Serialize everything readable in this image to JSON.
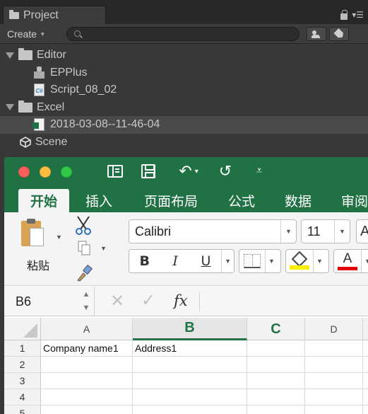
{
  "unity": {
    "panel_tab": "Project",
    "create_label": "Create",
    "search_placeholder": "",
    "tree": [
      {
        "label": "Editor",
        "type": "folder"
      },
      {
        "label": "EPPlus",
        "type": "dll"
      },
      {
        "label": "Script_08_02",
        "type": "cs-script"
      },
      {
        "label": "Excel",
        "type": "folder"
      },
      {
        "label": "2018-03-08--11-46-04",
        "type": "excel-file",
        "selected": true
      },
      {
        "label": "Scene",
        "type": "unity-scene"
      }
    ]
  },
  "excel": {
    "quick_access": {
      "undo_glyph": "↶",
      "redo_glyph": "↺",
      "more_glyph": "⩡"
    },
    "ribbon_tabs": [
      "开始",
      "插入",
      "页面布局",
      "公式",
      "数据",
      "审阅"
    ],
    "active_tab": "开始",
    "clipboard": {
      "paste_label": "粘贴"
    },
    "font": {
      "family": "Calibri",
      "size": "11",
      "grow_glyph": "A",
      "bold": "B",
      "italic": "I",
      "underline": "U",
      "font_color_glyph": "A"
    },
    "formula_bar": {
      "name_box": "B6",
      "fx_label": "fx",
      "cancel_glyph": "✕",
      "enter_glyph": "✓",
      "formula": ""
    },
    "colors": {
      "brand": "#207245",
      "accent": "#217346",
      "fill_color": "#F6EF00",
      "font_color": "#E00000"
    },
    "columns": [
      "A",
      "B",
      "C",
      "D"
    ],
    "selected_column": "B",
    "rows": [
      {
        "num": "1",
        "cells": [
          "Company name1",
          "Address1",
          "",
          ""
        ]
      },
      {
        "num": "2",
        "cells": [
          "",
          "",
          "",
          ""
        ]
      },
      {
        "num": "3",
        "cells": [
          "",
          "",
          "",
          ""
        ]
      },
      {
        "num": "4",
        "cells": [
          "",
          "",
          "",
          ""
        ]
      },
      {
        "num": "5",
        "cells": [
          "",
          "",
          "",
          ""
        ]
      }
    ]
  }
}
